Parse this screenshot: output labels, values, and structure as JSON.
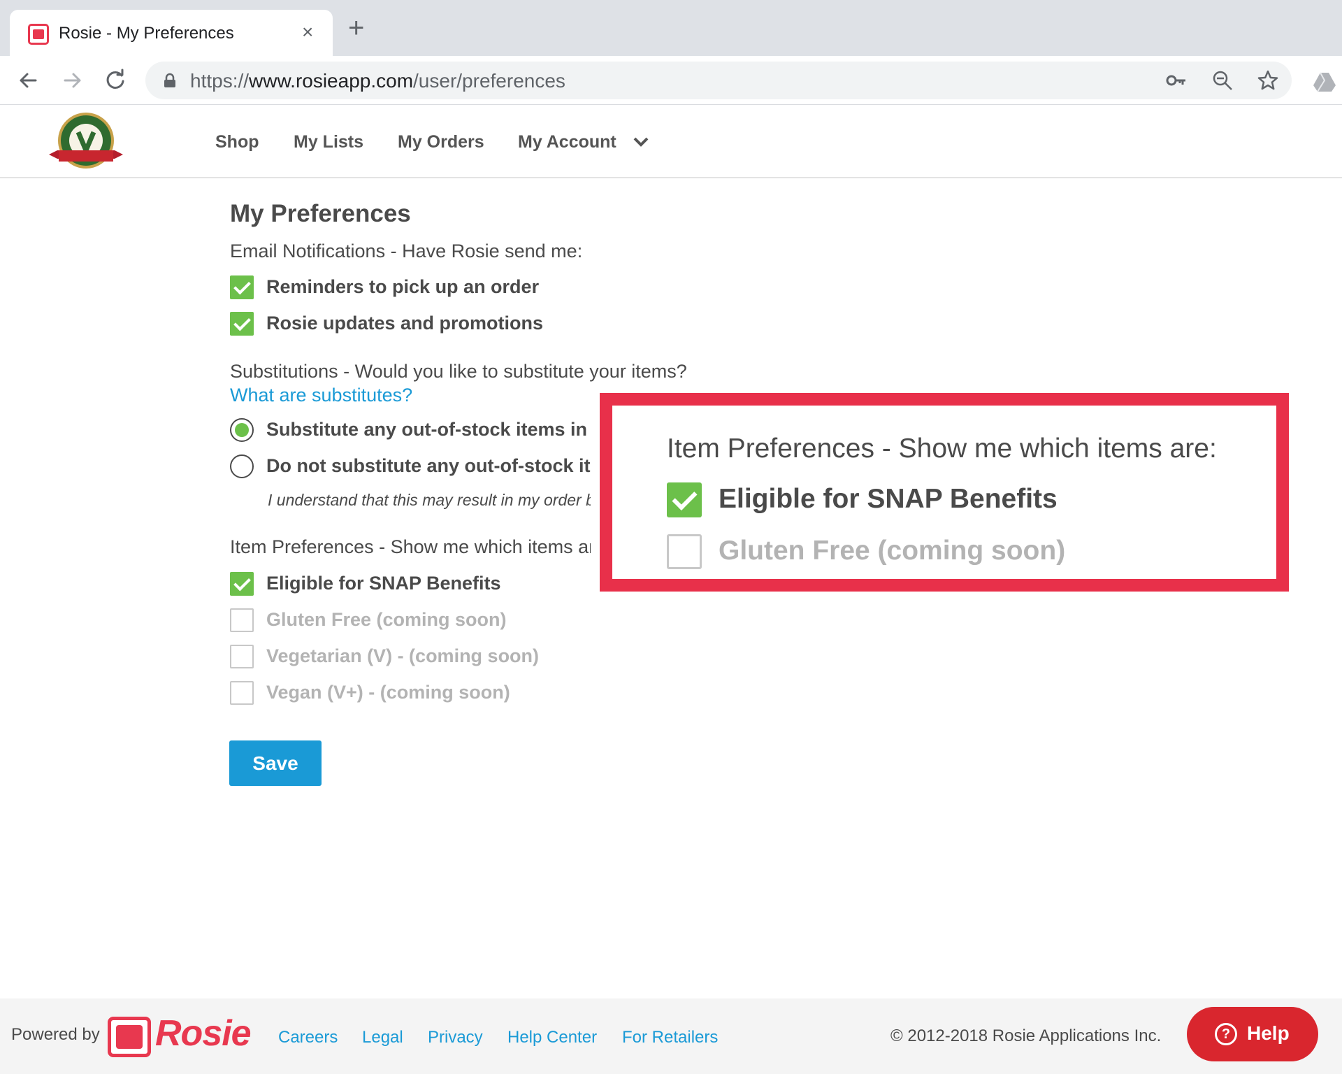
{
  "browser": {
    "tab_title": "Rosie - My Preferences",
    "tab_close": "×",
    "new_tab": "+",
    "url_scheme": "https://",
    "url_host": "www.rosieapp.com",
    "url_path": "/user/preferences"
  },
  "nav": {
    "shop": "Shop",
    "my_lists": "My Lists",
    "my_orders": "My Orders",
    "my_account": "My Account"
  },
  "page": {
    "title": "My Preferences",
    "email_section_label": "Email Notifications - Have Rosie send me:",
    "email_options": [
      {
        "label": "Reminders to pick up an order",
        "checked": true
      },
      {
        "label": "Rosie updates and promotions",
        "checked": true
      }
    ],
    "substitutions_label": "Substitutions - Would you like to substitute your items?",
    "substitutes_link": "What are substitutes?",
    "substitution_options": [
      {
        "label": "Substitute any out-of-stock items in my order",
        "selected": true
      },
      {
        "label": "Do not substitute any out-of-stock items in my order",
        "selected": false
      }
    ],
    "substitution_disclaimer": "I understand that this may result in my order being incomplete.",
    "item_pref_label": "Item Preferences - Show me which items are:",
    "item_options": [
      {
        "label": "Eligible for SNAP Benefits",
        "checked": true,
        "disabled": false
      },
      {
        "label": "Gluten Free (coming soon)",
        "checked": false,
        "disabled": true
      },
      {
        "label": "Vegetarian (V) - (coming soon)",
        "checked": false,
        "disabled": true
      },
      {
        "label": "Vegan (V+) - (coming soon)",
        "checked": false,
        "disabled": true
      }
    ],
    "save_label": "Save"
  },
  "callout": {
    "title": "Item Preferences - Show me which items are:",
    "items": [
      {
        "label": "Eligible for SNAP Benefits",
        "checked": true
      },
      {
        "label": "Gluten Free (coming soon)",
        "checked": false
      }
    ],
    "border_color": "#e8304a"
  },
  "footer": {
    "powered_by": "Powered by",
    "brand": "Rosie",
    "links": [
      "Careers",
      "Legal",
      "Privacy",
      "Help Center",
      "For Retailers"
    ],
    "copyright": "© 2012-2018 Rosie Applications Inc.",
    "help_label": "Help",
    "help_icon": "?"
  },
  "colors": {
    "accent_blue": "#1a9ad6",
    "check_green": "#6cc04a",
    "rosie_red": "#e8384f",
    "help_red": "#d9262e"
  },
  "icons": [
    "lock-icon",
    "back-arrow-icon",
    "forward-arrow-icon",
    "reload-icon",
    "key-icon",
    "zoom-icon",
    "star-icon",
    "drive-icon",
    "chevron-down-icon",
    "question-icon"
  ]
}
